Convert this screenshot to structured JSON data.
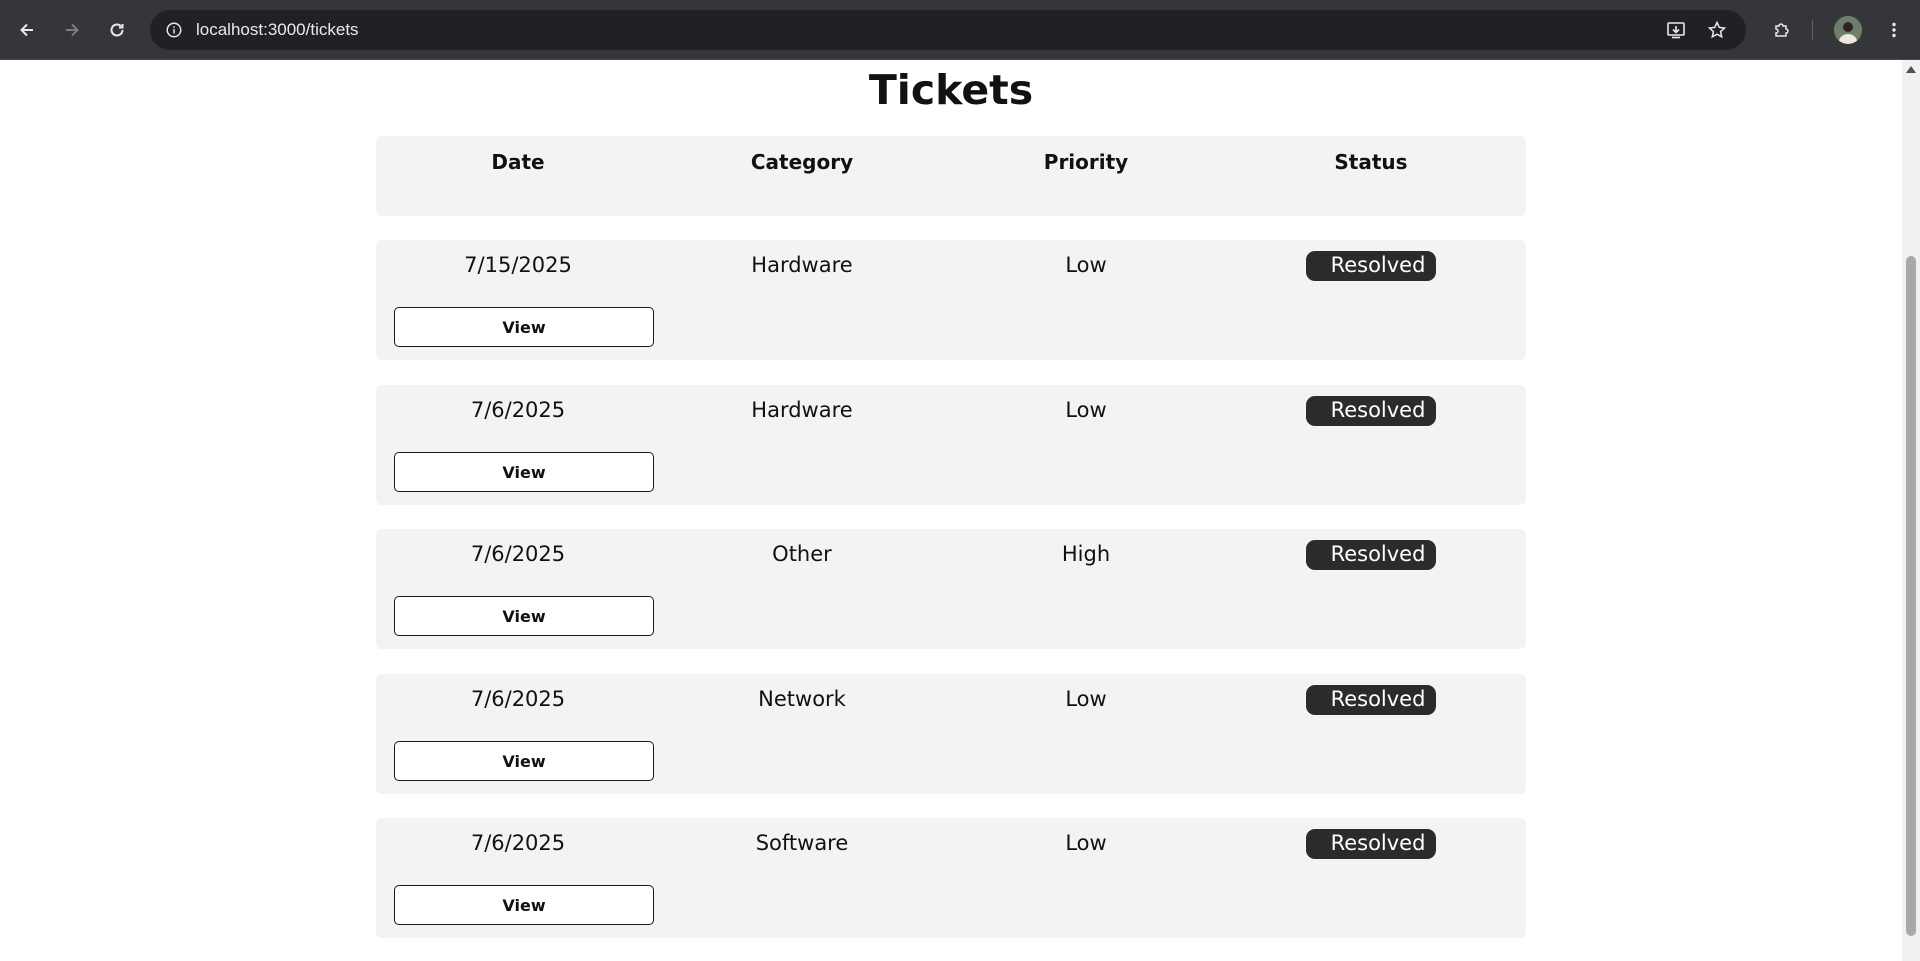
{
  "browser": {
    "url": "localhost:3000/tickets"
  },
  "page": {
    "title": "Tickets"
  },
  "table": {
    "headers": [
      "Date",
      "Category",
      "Priority",
      "Status"
    ],
    "view_label": "View",
    "rows": [
      {
        "date": "7/15/2025",
        "category": "Hardware",
        "priority": "Low",
        "status": "Resolved"
      },
      {
        "date": "7/6/2025",
        "category": "Hardware",
        "priority": "Low",
        "status": "Resolved"
      },
      {
        "date": "7/6/2025",
        "category": "Other",
        "priority": "High",
        "status": "Resolved"
      },
      {
        "date": "7/6/2025",
        "category": "Network",
        "priority": "Low",
        "status": "Resolved"
      },
      {
        "date": "7/6/2025",
        "category": "Software",
        "priority": "Low",
        "status": "Resolved"
      }
    ]
  },
  "colors": {
    "chrome_bg": "#35363a",
    "omnibox_bg": "#202124",
    "card_bg": "#f3f3f3",
    "badge_bg": "#2b2b2b"
  }
}
